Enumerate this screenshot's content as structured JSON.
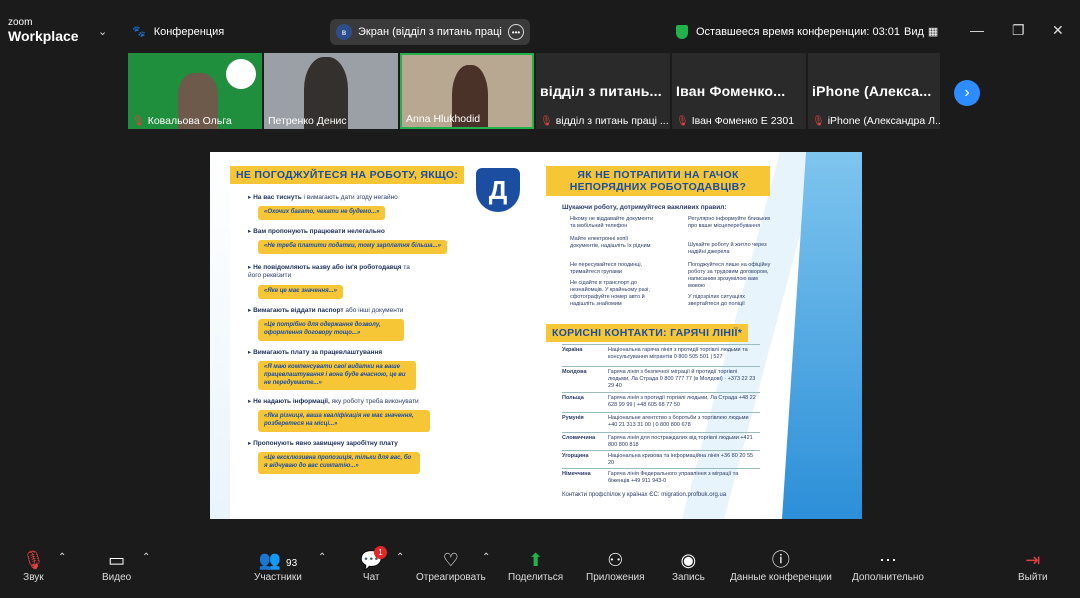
{
  "app": {
    "logo_top": "zoom",
    "logo_bottom": "Workplace",
    "conference_label": "Конференция"
  },
  "screen_pill": {
    "badge": "в",
    "label": "Экран (відділ з питань праці Сум"
  },
  "timer": {
    "label": "Оставшееся время конференции: 03:01"
  },
  "view": {
    "label": "Вид"
  },
  "participants": [
    {
      "name": "Ковальова Ольга"
    },
    {
      "name": "Петренко Денис"
    },
    {
      "name": "Anna Hlukhodid"
    },
    {
      "big": "відділ з питань...",
      "name": "відділ з питань праці ..."
    },
    {
      "big": "Іван Фоменко...",
      "name": "Іван Фоменко Е 2301"
    },
    {
      "big": "iPhone (Алекса...",
      "name": "iPhone (Александра Л..."
    }
  ],
  "doc": {
    "title_left": "НЕ ПОГОДЖУЙТЕСЯ НА РОБОТУ, ЯКЩО:",
    "items": [
      {
        "head": "На вас тиснуть",
        "rest": " і вимагають дати згоду негайно",
        "quote": "«Охочих багато, чекати не будемо...»"
      },
      {
        "head": "Вам пропонують працювати нелегально",
        "rest": "",
        "quote": "«Не треба платити податки, тому зарплатня більша...»"
      },
      {
        "head": "Не повідомляють назву або ім'я роботодавця",
        "rest": " та його реквізити",
        "quote": "«Яке це має значення...»"
      },
      {
        "head": "Вимагають віддати паспорт",
        "rest": " або інші документи",
        "quote": "«Це потрібно для одержання дозволу, оформлення договору тощо...»"
      },
      {
        "head": "Вимагають плату за працевлаштування",
        "rest": "",
        "quote": "«Я маю компенсувати свої видатки на ваше працевлаштування і вона буде вчасною, це ви не передумаєте...»"
      },
      {
        "head": "Не надають інформації,",
        "rest": " яку роботу треба виконувати",
        "quote": "«Яка різниця, ваша кваліфікація не має значення, розберетеся на місці...»"
      },
      {
        "head": "Пропонують явно завищену заробітну плату",
        "rest": "",
        "quote": "«Це ексклюзивна пропозиція, тільки для вас, бо я відчуваю до вас симпатію...»"
      }
    ],
    "logo": "Д",
    "title_right": "ЯК НЕ ПОТРАПИТИ НА ГАЧОК НЕПОРЯДНИХ РОБОТОДАВЦІВ?",
    "tips_intro": "Шукаючи роботу, дотримуйтеся важливих правил:",
    "tips_left": [
      "Нікому не віддавайте документи та мобільний телефон",
      "Майте електронні копії документів, надішліть їх рідним",
      "Не пересувайтеся поодинці, тримайтеся групами",
      "Не сідайте в транспорт до незнайомців. У крайньому разі, сфотографуйте номер авто й надішліть знайомим"
    ],
    "tips_right": [
      "Регулярно інформуйте близьких про ваше місцеперебування",
      "Шукайте роботу й житло через надійні джерела",
      "Погоджуйтеся лише на офіційну роботу за трудовим договором, написаним зрозумілою вам мовою",
      "У підозрілих ситуаціях звертайтеся до поліції"
    ],
    "contacts_title": "КОРИСНІ КОНТАКТИ: ГАРЯЧІ ЛІНІЇ*",
    "contacts": [
      {
        "country": "Україна",
        "detail": "Національна гаряча лінія з протидії торгівлі людьми та консультування мігрантів 0 800 505 501 | 527"
      },
      {
        "country": "Молдова",
        "detail": "Гаряча лінія з безпечної міграції й протидії торгівлі людьми, Ла Страда 0 800 777 77 (в Молдові) · +373 22 23 29 40"
      },
      {
        "country": "Польща",
        "detail": "Гаряча лінія з протидії торгівлі людьми, Ла Страда +48 22 628 99 99 | +48 605 68 77 50"
      },
      {
        "country": "Румунія",
        "detail": "Національне агентство з боротьби з торгівлею людьми +40 21 313 31 00 | 0 800 800 678"
      },
      {
        "country": "Словаччина",
        "detail": "Гаряча лінія для постраждалих від торгівлі людьми +421 800 800 818"
      },
      {
        "country": "Угорщина",
        "detail": "Національна кризова та інформаційна лінія +36 80 20 55 20"
      },
      {
        "country": "Німеччина",
        "detail": "Гаряча лінія Федерального управління з міграції та біженців +49 911 943-0"
      }
    ],
    "footer": "Контакти профспілок у країнах ЄС: migration.profbuk.org.ua"
  },
  "toolbar": {
    "mute": "Звук",
    "video": "Видео",
    "participants": "Участники",
    "participants_count": "93",
    "chat": "Чат",
    "chat_badge": "1",
    "react": "Отреагировать",
    "share": "Поделиться",
    "apps": "Приложения",
    "record": "Запись",
    "info": "Данные конференции",
    "more": "Дополнительно",
    "leave": "Выйти"
  }
}
